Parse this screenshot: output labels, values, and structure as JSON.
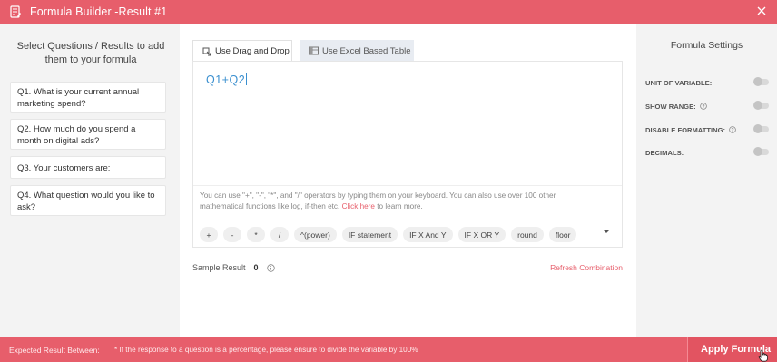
{
  "window": {
    "title": "Formula Builder -Result #1",
    "title_icon": "form-icon",
    "close_icon": "close-icon"
  },
  "left_panel": {
    "heading": "Select Questions / Results to add them to your formula",
    "questions": [
      {
        "label": "Q1. What is your current annual marketing spend?"
      },
      {
        "label": "Q2. How much do you spend a month on digital ads?"
      },
      {
        "label": "Q3. Your customers are:"
      },
      {
        "label": "Q4. What question would you like to ask?"
      }
    ]
  },
  "editor": {
    "tabs": [
      {
        "label": "Use Drag and Drop",
        "icon": "drag-drop-icon",
        "active": true
      },
      {
        "label": "Use Excel Based Table",
        "icon": "excel-icon",
        "active": false
      }
    ],
    "formula": "Q1+Q2",
    "help_text": "You can use \"+\", \"-\", \"*\", and \"/\" operators by typing them on your keyboard. You can also use over 100 other mathematical functions like log, if-then etc.",
    "help_link": "Click here",
    "help_suffix": "to learn more.",
    "operators": [
      "+",
      "-",
      "*",
      "/",
      "^(power)",
      "IF statement",
      "IF X And Y",
      "IF X OR Y",
      "round",
      "floor"
    ],
    "sample_label": "Sample Result",
    "sample_value": "0",
    "refresh_label": "Refresh Combination"
  },
  "settings": {
    "heading": "Formula Settings",
    "items": [
      {
        "label": "UNIT OF VARIABLE:",
        "info": false,
        "on": false
      },
      {
        "label": "SHOW RANGE:",
        "info": true,
        "on": false
      },
      {
        "label": "DISABLE FORMATTING:",
        "info": true,
        "on": false
      },
      {
        "label": "DECIMALS:",
        "info": false,
        "on": false
      }
    ]
  },
  "footer": {
    "label": "Expected Result Between:",
    "note": "* If the response to a question is a percentage, please ensure to divide the variable by 100%",
    "apply_label": "Apply Formula"
  },
  "colors": {
    "accent": "#e75e6b",
    "formula_text": "#3a8fcf"
  }
}
